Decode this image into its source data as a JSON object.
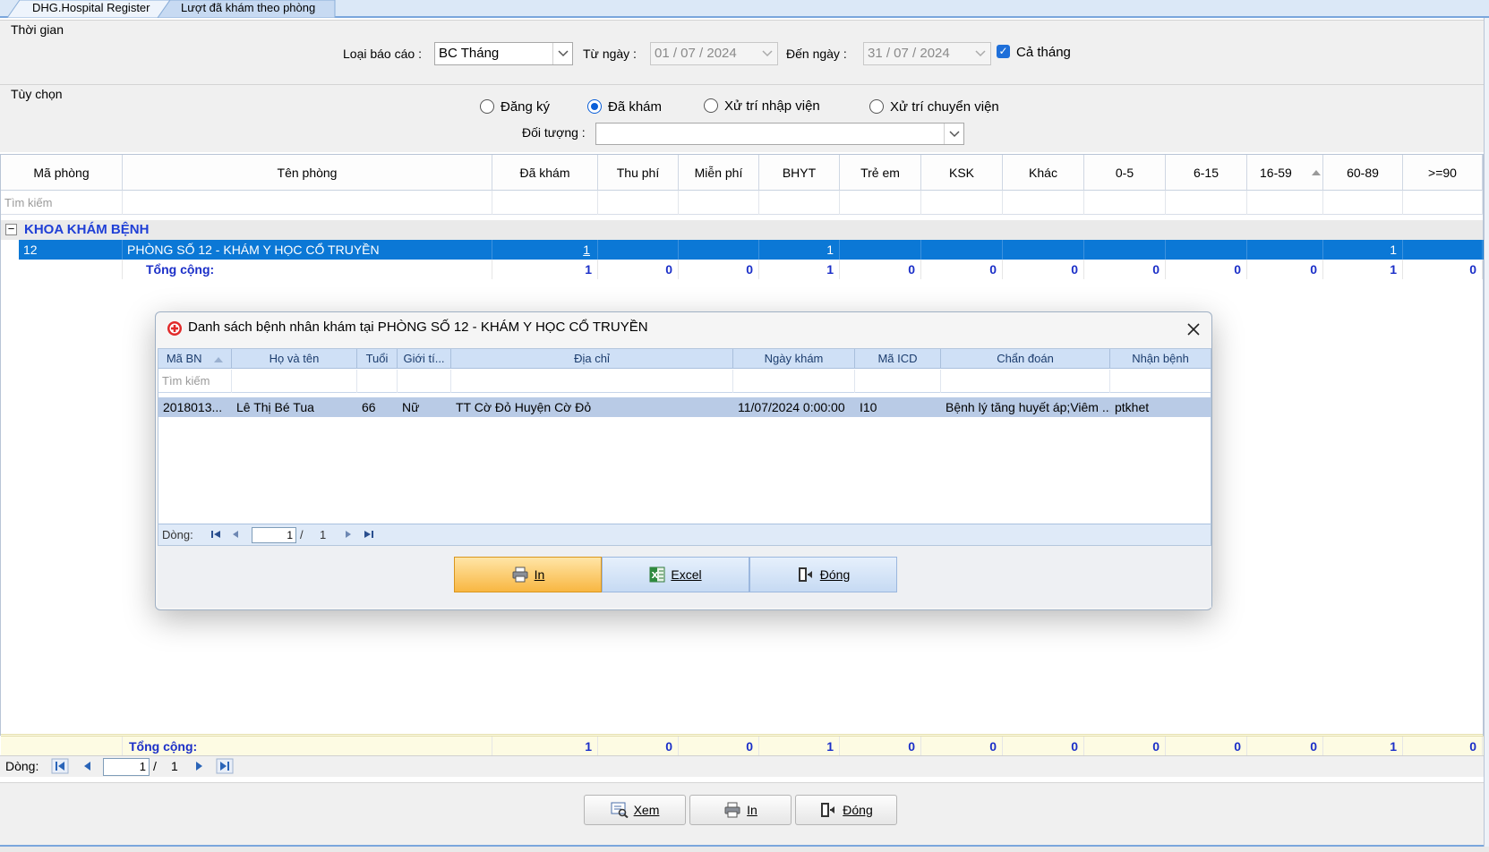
{
  "tabs": [
    "DHG.Hospital Register",
    "Lượt đã khám theo phòng"
  ],
  "thoi_gian": {
    "section_title": "Thời gian",
    "loai_bao_cao_label": "Loại báo cáo :",
    "loai_bao_cao_value": "BC Tháng",
    "tu_ngay_label": "Từ ngày :",
    "tu_ngay_value": "01 / 07 / 2024",
    "den_ngay_label": "Đến ngày :",
    "den_ngay_value": "31 / 07 / 2024",
    "ca_thang_label": "Cả tháng"
  },
  "tuy_chon": {
    "section_title": "Tùy chọn",
    "radios": [
      "Đăng ký",
      "Đã khám",
      "Xử trí nhập viện",
      "Xử trí chuyển viện"
    ],
    "selected_radio": "Đã khám",
    "doi_tuong_label": "Đối tượng :",
    "doi_tuong_value": ""
  },
  "grid": {
    "columns": [
      "Mã phòng",
      "Tên phòng",
      "Đã khám",
      "Thu phí",
      "Miễn phí",
      "BHYT",
      "Trẻ em",
      "KSK",
      "Khác",
      "0-5",
      "6-15",
      "16-59",
      "60-89",
      ">=90"
    ],
    "search_placeholder": "Tìm kiếm",
    "group_toggle": "−",
    "group_name": "KHOA KHÁM BỆNH",
    "row": {
      "ma_phong": "12",
      "ten_phong": "PHÒNG SỐ 12 - KHÁM Y HỌC CỔ TRUYỀN",
      "da_kham": "1",
      "thu_phi": "",
      "mien_phi": "",
      "bhyt": "1",
      "tre_em": "",
      "ksk": "",
      "khac": "",
      "a0_5": "",
      "a6_15": "",
      "a16_59": "",
      "a60_89": "1",
      "a90": ""
    },
    "total_label": "Tổng cộng:",
    "totals": [
      "1",
      "0",
      "0",
      "1",
      "0",
      "0",
      "0",
      "0",
      "0",
      "0",
      "1",
      "0"
    ]
  },
  "navigator": {
    "label": "Dòng:",
    "current": "1",
    "separator": "/",
    "total": "1"
  },
  "bottom_buttons": {
    "xem": "Xem",
    "in": "In",
    "dong": "Đóng"
  },
  "dialog": {
    "title": "Danh sách bệnh nhân khám tại PHÒNG SỐ 12 - KHÁM Y HỌC CỔ TRUYỀN",
    "columns": [
      "Mã BN",
      "Họ và tên",
      "Tuổi",
      "Giới tí...",
      "Địa chỉ",
      "Ngày khám",
      "Mã ICD",
      "Chẩn đoán",
      "Nhận bệnh"
    ],
    "search_placeholder": "Tìm kiếm",
    "row": {
      "ma_bn": "2018013...",
      "ho_ten": "Lê Thị Bé Tua",
      "tuoi": "66",
      "gioi_tinh": "Nữ",
      "dia_chi": "TT Cờ Đỏ Huyện Cờ Đỏ",
      "ngay_kham": "11/07/2024 0:00:00",
      "ma_icd": "I10",
      "chan_doan": "Bệnh lý tăng huyết áp;Viêm ...",
      "nhan_benh": "ptkhet"
    },
    "navigator": {
      "label": "Dòng:",
      "current": "1",
      "separator": "/",
      "total": "1"
    },
    "buttons": {
      "in": "In",
      "excel": "Excel",
      "dong": "Đóng"
    }
  },
  "colors": {
    "selection": "#0b78d6",
    "total_text": "#1b2fc8",
    "group_text": "#1f3fd6",
    "checkbox": "#1e6fd9"
  }
}
